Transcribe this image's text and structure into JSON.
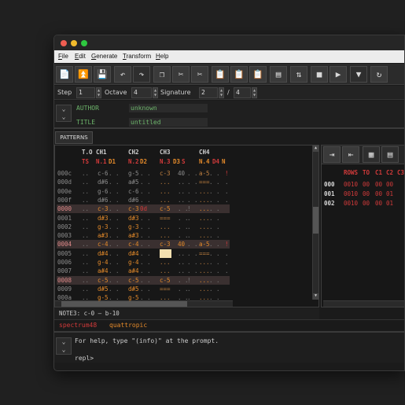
{
  "menu": [
    "File",
    "Edit",
    "Generate",
    "Transform",
    "Help"
  ],
  "controls": {
    "step_label": "Step",
    "step_value": "1",
    "octave_label": "Octave",
    "octave_value": "4",
    "signature_label": "Signature",
    "sig_num": "2",
    "sig_sep": "/",
    "sig_den": "4"
  },
  "meta": {
    "author_label": "AUTHOR",
    "author_value": "unknown",
    "title_label": "TITLE",
    "title_value": "untitled"
  },
  "patterns_tab": "PATTERNS",
  "pattern": {
    "channel_headers": [
      "T.O",
      "CH1",
      "CH2",
      "CH3",
      "CH4"
    ],
    "sub_headers": [
      "TS",
      "N.1",
      "D1",
      "N.2",
      "D2",
      "N.3",
      "D3",
      "S",
      "N.4",
      "D4",
      "N"
    ],
    "rows": [
      [
        "000c",
        "..",
        "c-6",
        ". .",
        "g-5",
        ". .",
        "c-3",
        "40",
        ". .",
        "a-5",
        ". .",
        "!"
      ],
      [
        "000d",
        "..",
        "d#6",
        ". .",
        "a#5",
        ". .",
        "...",
        "..",
        ". .",
        "===",
        ". .",
        "."
      ],
      [
        "000e",
        "..",
        "g-6",
        ". .",
        "c-6",
        ". .",
        "...",
        "..",
        ". .",
        "...",
        ". .",
        "."
      ],
      [
        "000f",
        "..",
        "d#6",
        ". .",
        "d#6",
        ". .",
        "...",
        "..",
        ". .",
        "...",
        ". .",
        "."
      ],
      [
        "0000",
        "..",
        "c-3",
        ". .",
        "c-3",
        "0d",
        "c-5",
        ". .",
        "!",
        "...",
        ". .",
        ""
      ],
      [
        "0001",
        "..",
        "d#3",
        ". .",
        "d#3",
        ". .",
        "===",
        ". .",
        ".",
        "...",
        ". .",
        ""
      ],
      [
        "0002",
        "..",
        "g-3",
        ". .",
        "g-3",
        ". .",
        "...",
        ". .",
        ".",
        "...",
        ". .",
        ""
      ],
      [
        "0003",
        "..",
        "a#3",
        ". .",
        "a#3",
        ". .",
        "...",
        ". .",
        ".",
        "...",
        ". .",
        ""
      ],
      [
        "0004",
        "..",
        "c-4",
        ". .",
        "c-4",
        ". .",
        "c-3",
        "40",
        ". .",
        "a-5",
        ". .",
        "!"
      ],
      [
        "0005",
        "..",
        "d#4",
        ". .",
        "d#4",
        ". .",
        "...",
        "..",
        ". .",
        "===",
        ". .",
        "."
      ],
      [
        "0006",
        "..",
        "g-4",
        ". .",
        "g-4",
        ". .",
        "...",
        "..",
        ". .",
        "...",
        ". .",
        "."
      ],
      [
        "0007",
        "..",
        "a#4",
        ". .",
        "a#4",
        ". .",
        "...",
        "..",
        ". .",
        "...",
        ". .",
        "."
      ],
      [
        "0008",
        "..",
        "c-5",
        ". .",
        "c-5",
        ". .",
        "c-5",
        ". .",
        "!",
        "...",
        ". .",
        ""
      ],
      [
        "0009",
        "..",
        "d#5",
        ". .",
        "d#5",
        ". .",
        "===",
        ". .",
        ".",
        "...",
        ". .",
        ""
      ],
      [
        "000a",
        "..",
        "g-5",
        ". .",
        "g-5",
        ". .",
        "...",
        ". .",
        ".",
        "...",
        ". .",
        ""
      ]
    ]
  },
  "note_status": "NOTE3: c-0 – b-10",
  "sequence": {
    "headers": [
      "ROWS",
      "TO",
      "C1",
      "C2",
      "C3"
    ],
    "rows": [
      [
        "000",
        "0010",
        "00",
        "00",
        "00"
      ],
      [
        "001",
        "0010",
        "00",
        "00",
        "01"
      ],
      [
        "002",
        "0010",
        "00",
        "00",
        "01"
      ]
    ]
  },
  "status": {
    "platform": "spectrum48",
    "engine": "quattropic"
  },
  "repl": {
    "help": "For help, type \"(info)\" at the prompt.",
    "prompt": "repl>"
  },
  "colors": {
    "accent_red": "#d23a3a",
    "accent_orange": "#e48a2a",
    "green": "#6cb36a"
  }
}
